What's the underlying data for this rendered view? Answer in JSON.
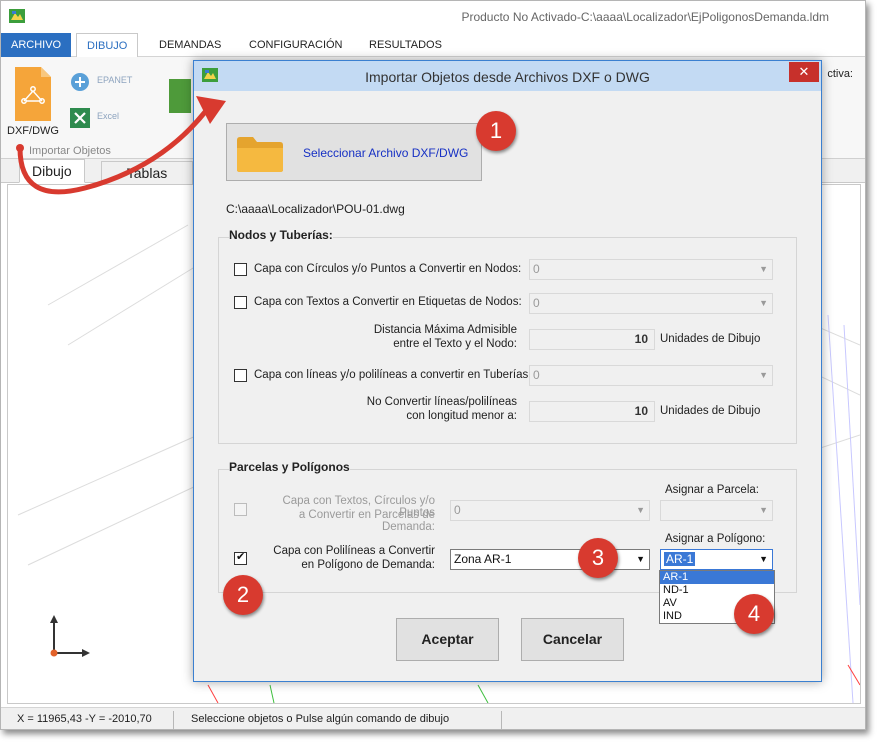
{
  "window": {
    "title": "Producto No Activado-C:\\aaaa\\Localizador\\EjPoligonosDemanda.ldm"
  },
  "menu": {
    "tabs": [
      "ARCHIVO",
      "DIBUJO",
      "DEMANDAS",
      "CONFIGURACIÓN",
      "RESULTADOS"
    ]
  },
  "ribbon": {
    "dxf_label": "DXF/DWG",
    "epanet_label": "EPANET",
    "excel_label": "Excel",
    "group_label": "Importar Objetos",
    "right_label": "ctiva:"
  },
  "view_tabs": [
    "Dibujo",
    "Tablas"
  ],
  "statusbar": {
    "coords": "X = 11965,43 -Y = -2010,70",
    "message": "Seleccione objetos o Pulse algún comando de dibujo"
  },
  "dialog": {
    "title": "Importar Objetos desde Archivos DXF o DWG",
    "close": "✕",
    "select_file_label": "Seleccionar Archivo DXF/DWG",
    "file_path": "C:\\aaaa\\Localizador\\POU-01.dwg",
    "nodos_group": {
      "title": "Nodos y Tuberías:",
      "circles_label": "Capa con Círculos y/o Puntos a Convertir en Nodos:",
      "circles_value": "0",
      "texts_label": "Capa con Textos a Convertir en Etiquetas de Nodos:",
      "texts_value": "0",
      "distance_label_1": "Distancia Máxima Admisible",
      "distance_label_2": "entre el Texto y el Nodo:",
      "distance_value": "10",
      "distance_unit": "Unidades de Dibujo",
      "lines_label": "Capa con líneas y/o polilíneas a convertir en Tuberías:",
      "lines_value": "0",
      "minlen_label_1": "No Convertir líneas/polilíneas",
      "minlen_label_2": "con longitud menor a:",
      "minlen_value": "10",
      "minlen_unit": "Unidades de Dibujo"
    },
    "parcelas_group": {
      "title": "Parcelas y Polígonos",
      "parcel_label_1": "Capa con Textos, Círculos y/o Puntos",
      "parcel_label_2": "a Convertir en Parcelas de Demanda:",
      "parcel_value": "0",
      "assign_parcel_label": "Asignar a Parcela:",
      "polyline_label_1": "Capa con Polilíneas  a Convertir",
      "polyline_label_2": "en Polígono de Demanda:",
      "polyline_value": "Zona AR-1",
      "assign_polygon_label": "Asignar a Polígono:",
      "assign_polygon_value": "AR-1",
      "polygon_options": [
        "AR-1",
        "ND-1",
        "AV",
        "IND"
      ]
    },
    "accept_label": "Aceptar",
    "cancel_label": "Cancelar"
  },
  "callouts": [
    "1",
    "2",
    "3",
    "4"
  ],
  "colors": {
    "accent": "#2b6fc1",
    "callout": "#d83a2f",
    "dialog_title_bg": "#c3daf3",
    "close_btn": "#c7302b"
  }
}
